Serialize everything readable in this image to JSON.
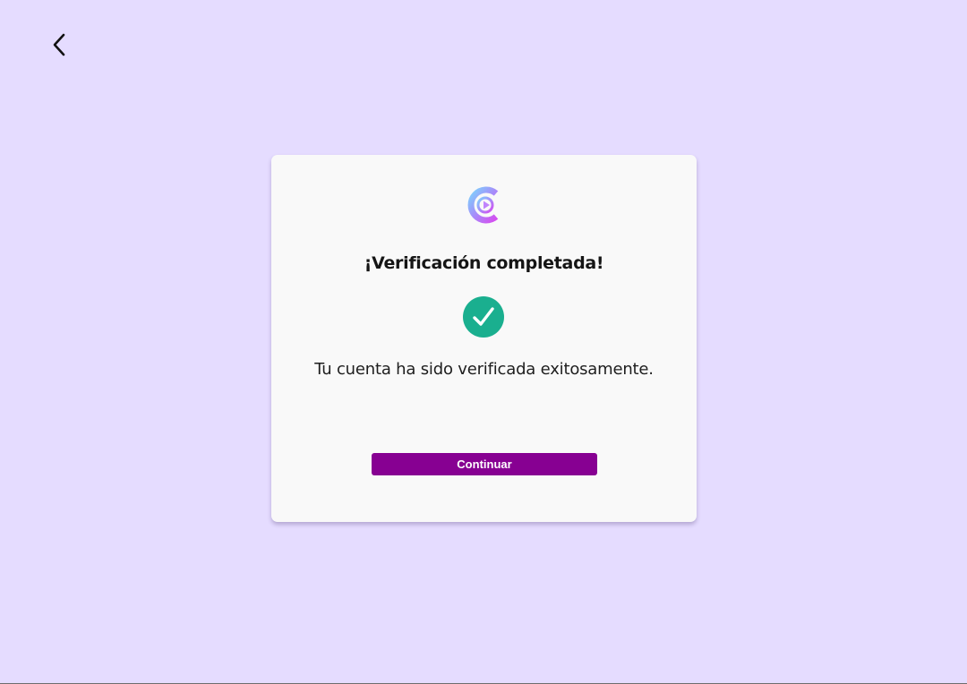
{
  "nav": {
    "back_icon": "chevron-left-icon"
  },
  "card": {
    "logo_icon": "brand-logo-icon",
    "title": "¡Verificación completada!",
    "status_icon": "check-circle-icon",
    "message": "Tu cuenta ha sido verificada exitosamente.",
    "continue_label": "Continuar"
  },
  "colors": {
    "background": "#e5dcff",
    "card": "#f9f9f9",
    "accent": "#870092",
    "success": "#1aaf8f",
    "logo_gradient_start": "#7dd3fc",
    "logo_gradient_end": "#d64cf0"
  }
}
